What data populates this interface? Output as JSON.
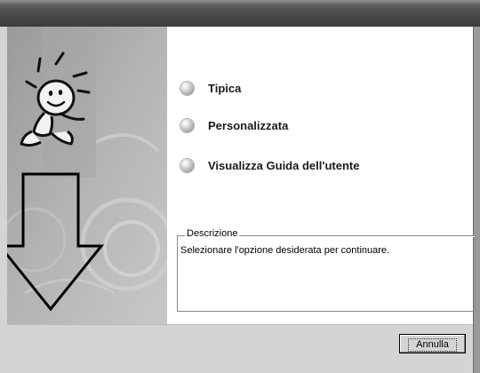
{
  "window": {
    "title": ""
  },
  "options": [
    {
      "label": "Tipica"
    },
    {
      "label": "Personalizzata"
    },
    {
      "label": "Visualizza Guida dell'utente"
    }
  ],
  "description": {
    "legend": "Descrizione",
    "text": "Selezionare l'opzione desiderata per continuare."
  },
  "buttons": {
    "cancel_label": "Annulla"
  },
  "icons": {
    "bullet": "round-bullet-icon",
    "mascot": "smiley-mascot-icon",
    "arrow": "down-arrow-icon"
  }
}
